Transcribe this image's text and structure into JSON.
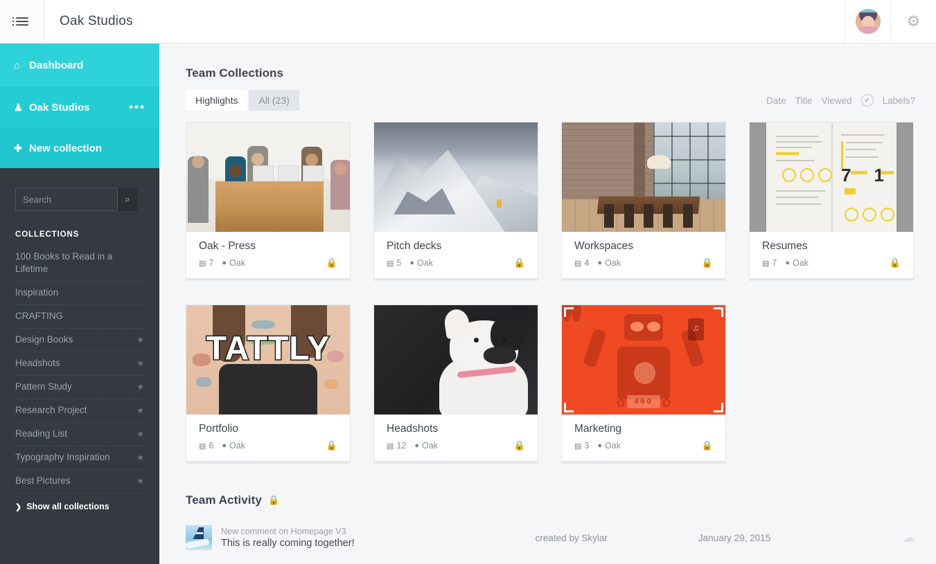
{
  "topbar": {
    "menu_icon": "hamburger-list-icon",
    "title": "Oak Studios",
    "avatar_name": "user-avatar",
    "gear_icon": "⚙"
  },
  "sidebar": {
    "nav": [
      {
        "label": "Dashboard",
        "icon": "home-icon",
        "glyph": "⌂"
      },
      {
        "label": "Oak Studios",
        "icon": "team-icon",
        "glyph": "♟",
        "more": "•••"
      },
      {
        "label": "New collection",
        "icon": "plus-icon",
        "glyph": "✚"
      }
    ],
    "search": {
      "placeholder": "Search",
      "value": "",
      "button_icon": "search-icon",
      "button_glyph": "⌕"
    },
    "collections_header": "COLLECTIONS",
    "collections": [
      {
        "label": "100 Books to Read in a Lifetime",
        "starred": false
      },
      {
        "label": "Inspiration",
        "starred": false
      },
      {
        "label": "CRAFTING",
        "starred": false
      },
      {
        "label": "Design Books",
        "starred": true
      },
      {
        "label": "Headshots",
        "starred": true
      },
      {
        "label": "Pattern Study",
        "starred": true
      },
      {
        "label": "Research Project",
        "starred": true
      },
      {
        "label": "Reading List",
        "starred": true
      },
      {
        "label": "Typography Inspiration",
        "starred": true
      },
      {
        "label": "Best Pictures",
        "starred": true
      }
    ],
    "show_all": "Show all collections",
    "show_all_chevron": "❯",
    "star_glyph": "★"
  },
  "main": {
    "section_title": "Team Collections",
    "tabs": [
      {
        "label": "Highlights",
        "active": true
      },
      {
        "label": "All (23)",
        "active": false
      }
    ],
    "sorts": [
      "Date",
      "Title",
      "Viewed"
    ],
    "labels_toggle": {
      "label": "Labels?",
      "icon": "check-circle-icon",
      "glyph": "✔"
    },
    "cards": [
      {
        "title": "Oak - Press",
        "count": "7",
        "owner": "Oak",
        "art": "team",
        "count_icon": "boards-icon",
        "owner_icon": "person-icon",
        "lock_icon": "lock-icon"
      },
      {
        "title": "Pitch decks",
        "count": "5",
        "owner": "Oak",
        "art": "mountain",
        "count_icon": "boards-icon",
        "owner_icon": "person-icon",
        "lock_icon": "lock-icon"
      },
      {
        "title": "Workspaces",
        "count": "4",
        "owner": "Oak",
        "art": "loft",
        "count_icon": "boards-icon",
        "owner_icon": "person-icon",
        "lock_icon": "lock-icon"
      },
      {
        "title": "Resumes",
        "count": "7",
        "owner": "Oak",
        "art": "resume",
        "count_icon": "boards-icon",
        "owner_icon": "person-icon",
        "lock_icon": "lock-icon"
      },
      {
        "title": "Portfolio",
        "count": "6",
        "owner": "Oak",
        "art": "tattly",
        "count_icon": "boards-icon",
        "owner_icon": "person-icon",
        "lock_icon": "lock-icon"
      },
      {
        "title": "Headshots",
        "count": "12",
        "owner": "Oak",
        "art": "dog",
        "count_icon": "boards-icon",
        "owner_icon": "person-icon",
        "lock_icon": "lock-icon"
      },
      {
        "title": "Marketing",
        "count": "3",
        "owner": "Oak",
        "art": "robot",
        "count_icon": "boards-icon",
        "owner_icon": "person-icon",
        "lock_icon": "lock-icon"
      }
    ],
    "card_art_text": {
      "tattly_word": "TATTLY",
      "robot_number": "460"
    }
  },
  "activity": {
    "title": "Team Activity",
    "lock_icon": "lock-icon",
    "items": [
      {
        "thumb": "airplane-tail-thumbnail",
        "title": "New comment on Homepage V3",
        "comment": "This is really coming together!",
        "created_by": "created by Skylar",
        "date": "January 29, 2015"
      }
    ],
    "cloud_icon": "cloud-upload-icon",
    "cloud_glyph": "☁"
  },
  "colors": {
    "teal": "#2ed3d9",
    "teal_mid": "#24cdd4",
    "teal_dark": "#1fc6ce",
    "sidebar_dark": "#343a40",
    "page_bg": "#f5f6f8",
    "text_dark": "#3d4450"
  }
}
